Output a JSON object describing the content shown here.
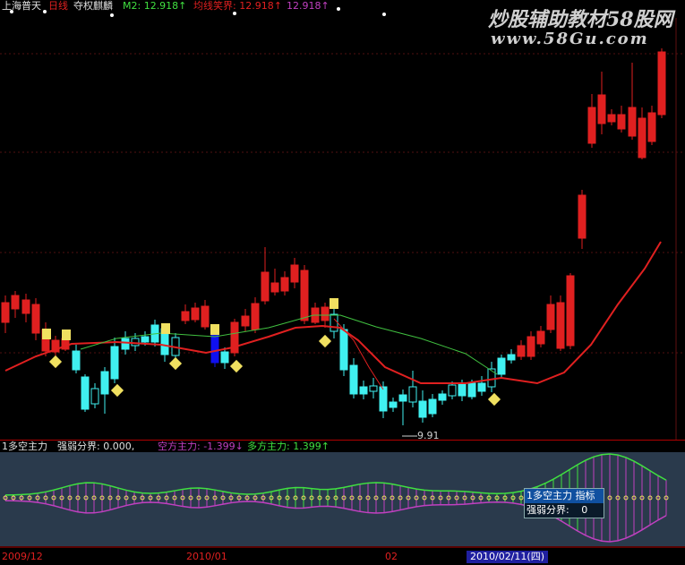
{
  "header": {
    "symbol": "上海普天",
    "period": "日线",
    "indicator": "夺权麒麟",
    "m2_label": "M2: 12.918↑",
    "ma_label": "均线笑界: 12.918↑",
    "ma_value": "12.918↑"
  },
  "watermark": {
    "cn": "炒股辅助教材58股网",
    "url": "www.58Gu.com"
  },
  "low_annotation": "9.91",
  "subpanel": {
    "name": "1多空主力",
    "line1": "强弱分界: 0.000,",
    "line2": "空方主力: -1.399↓",
    "line3": "多方主力: 1.399↑"
  },
  "tooltip": {
    "title": "1多空主力 指标",
    "row_label": "强弱分界:",
    "row_value": "0"
  },
  "xaxis": {
    "label1": "2009/12",
    "label2": "2010/01",
    "label3": "02",
    "cursor_date": "2010/02/11(四)"
  },
  "marker_glyph": "?",
  "colors": {
    "up": "#e02020",
    "down": "#40f0f0",
    "blue": "#1010f0",
    "ma_red": "#e02020",
    "ma_green": "#40c040",
    "sub_magenta": "#c040c0",
    "sub_green": "#40e040",
    "marker": "#f0e060"
  }
}
